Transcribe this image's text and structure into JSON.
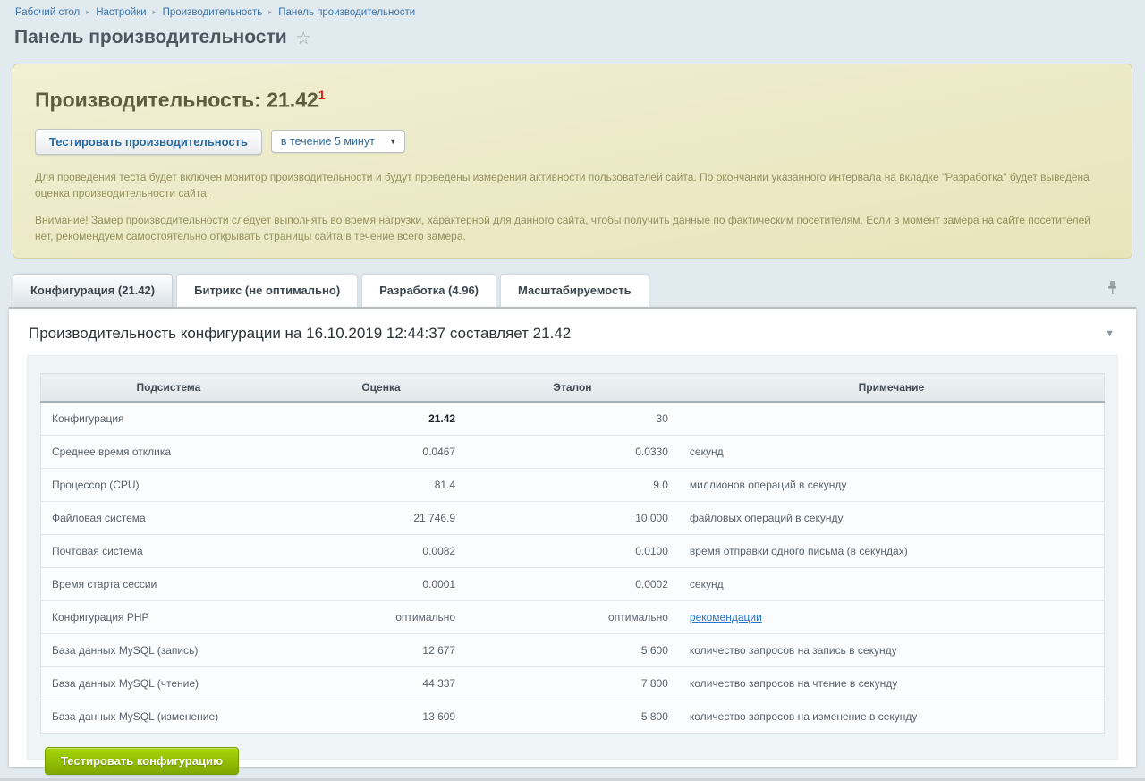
{
  "breadcrumb": {
    "items": [
      "Рабочий стол",
      "Настройки",
      "Производительность",
      "Панель производительности"
    ]
  },
  "page": {
    "title": "Панель производительности"
  },
  "perf_banner": {
    "heading_label": "Производительность:",
    "heading_value": "21.42",
    "heading_sup": "1",
    "test_button_label": "Тестировать производительность",
    "interval_select_value": "в течение 5 минут",
    "paragraph1": "Для проведения теста будет включен монитор производительности и будут проведены измерения активности пользователей сайта. По окончании указанного интервала на вкладке \"Разработка\" будет выведена оценка производительности сайта.",
    "paragraph2": "Внимание! Замер производительности следует выполнять во время нагрузки, характерной для данного сайта, чтобы получить данные по фактическим посетителям. Если в момент замера на сайте посетителей нет, рекомендуем самостоятельно открывать страницы сайта в течение всего замера."
  },
  "tabs": [
    {
      "label": "Конфигурация (21.42)",
      "active": true
    },
    {
      "label": "Битрикс (не оптимально)",
      "active": false
    },
    {
      "label": "Разработка (4.96)",
      "active": false
    },
    {
      "label": "Масштабируемость",
      "active": false
    }
  ],
  "icons": {
    "star": "☆",
    "breadcrumb_separator": "▸",
    "select_arrow": "▼",
    "collapse_arrow": "▼"
  },
  "section": {
    "title": "Производительность конфигурации на 16.10.2019 12:44:37 составляет 21.42"
  },
  "table": {
    "headers": [
      "Подсистема",
      "Оценка",
      "Эталон",
      "Примечание"
    ],
    "rows": [
      {
        "name": "Конфигурация",
        "score": "21.42",
        "score_bold": true,
        "etalon": "30",
        "note": "",
        "note_is_link": false
      },
      {
        "name": "Среднее время отклика",
        "score": "0.0467",
        "score_bold": false,
        "etalon": "0.0330",
        "note": "секунд",
        "note_is_link": false
      },
      {
        "name": "Процессор (CPU)",
        "score": "81.4",
        "score_bold": false,
        "etalon": "9.0",
        "note": "миллионов операций в секунду",
        "note_is_link": false
      },
      {
        "name": "Файловая система",
        "score": "21 746.9",
        "score_bold": false,
        "etalon": "10 000",
        "note": "файловых операций в секунду",
        "note_is_link": false
      },
      {
        "name": "Почтовая система",
        "score": "0.0082",
        "score_bold": false,
        "etalon": "0.0100",
        "note": "время отправки одного письма (в секундах)",
        "note_is_link": false
      },
      {
        "name": "Время старта сессии",
        "score": "0.0001",
        "score_bold": false,
        "etalon": "0.0002",
        "note": "секунд",
        "note_is_link": false
      },
      {
        "name": "Конфигурация PHP",
        "score": "оптимально",
        "score_bold": false,
        "etalon": "оптимально",
        "note": "рекомендации",
        "note_is_link": true
      },
      {
        "name": "База данных MySQL (запись)",
        "score": "12 677",
        "score_bold": false,
        "etalon": "5 600",
        "note": "количество запросов на запись в секунду",
        "note_is_link": false
      },
      {
        "name": "База данных MySQL (чтение)",
        "score": "44 337",
        "score_bold": false,
        "etalon": "7 800",
        "note": "количество запросов на чтение в секунду",
        "note_is_link": false
      },
      {
        "name": "База данных MySQL (изменение)",
        "score": "13 609",
        "score_bold": false,
        "etalon": "5 800",
        "note": "количество запросов на изменение в секунду",
        "note_is_link": false
      }
    ],
    "footer_button_label": "Тестировать конфигурацию"
  },
  "colors": {
    "page_background": "#e1eaef",
    "banner_background": "#ece8c2",
    "banner_heading": "#5e5c3e",
    "superscript_red": "#d9241c",
    "link_blue": "#2c72c8",
    "breadcrumb_blue": "#3c74a8",
    "green_button": "#8fbc03",
    "header_border": "#a6b1ba"
  }
}
